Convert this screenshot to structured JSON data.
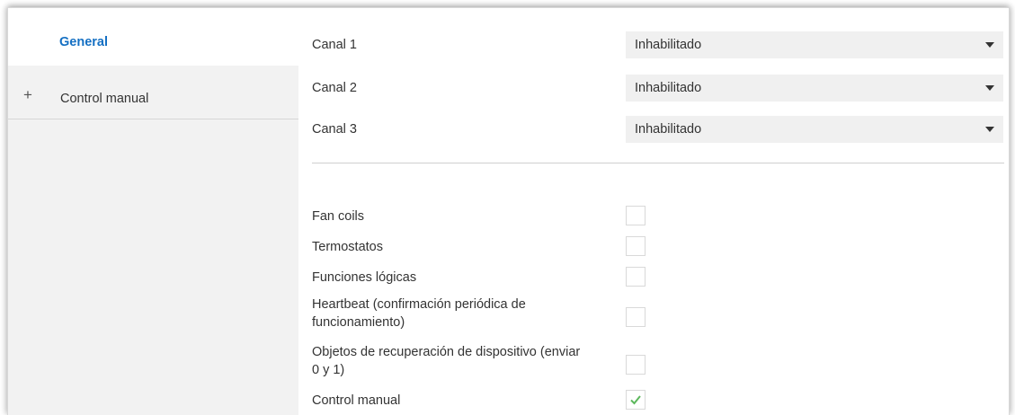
{
  "sidebar": {
    "items": [
      {
        "label": "General"
      },
      {
        "label": "Control manual",
        "expander": "+"
      }
    ]
  },
  "channels": [
    {
      "label": "Canal 1",
      "value": "Inhabilitado"
    },
    {
      "label": "Canal 2",
      "value": "Inhabilitado"
    },
    {
      "label": "Canal 3",
      "value": "Inhabilitado"
    }
  ],
  "options": [
    {
      "label": "Fan coils",
      "checked": false
    },
    {
      "label": "Termostatos",
      "checked": false
    },
    {
      "label": "Funciones lógicas",
      "checked": false
    },
    {
      "label_line1": "Heartbeat (confirmación periódica de",
      "label_line2": "funcionamiento)",
      "checked": false
    },
    {
      "label_line1": "Objetos de recuperación de dispositivo (enviar",
      "label_line2": "0 y 1)",
      "checked": false
    },
    {
      "label": "Control manual",
      "checked": true
    }
  ],
  "colors": {
    "accent": "#1570c3",
    "check_mark": "#5cb85c",
    "sidebar_bg": "#f2f2f2",
    "select_bg": "#f0f0f0"
  },
  "icons": {
    "dropdown": "chevron-down-icon",
    "expand": "plus-icon",
    "check": "checkmark-icon"
  }
}
